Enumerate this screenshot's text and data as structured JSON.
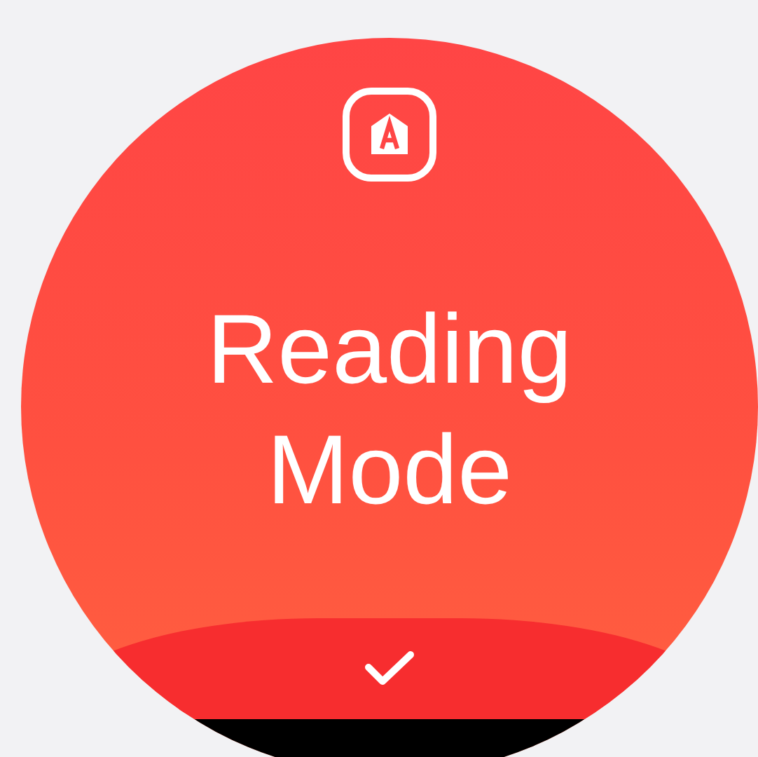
{
  "screen": {
    "title": "Reading Mode"
  }
}
